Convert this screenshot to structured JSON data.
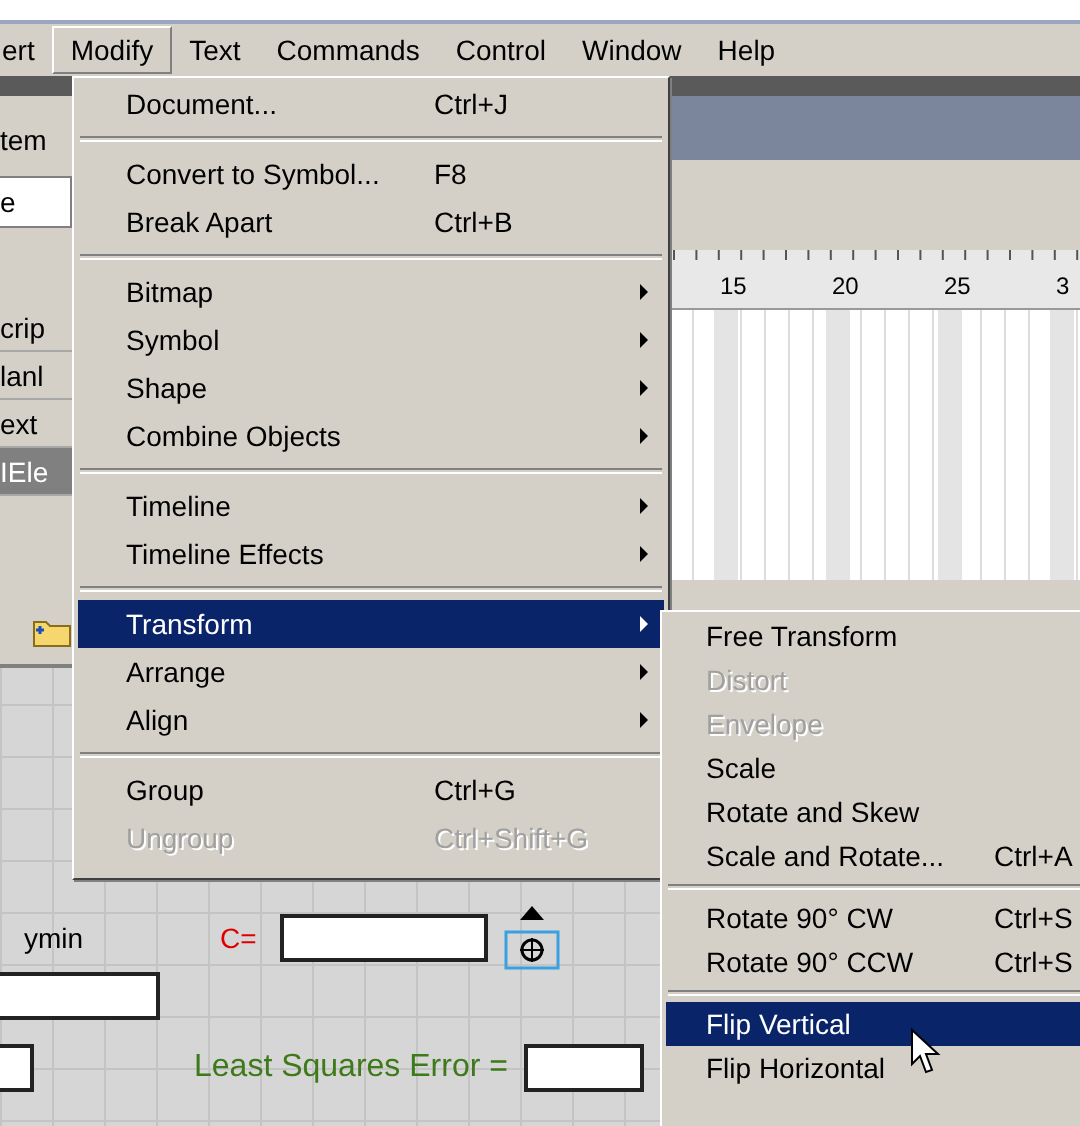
{
  "menu_bar": [
    {
      "label": "ert",
      "selected": false
    },
    {
      "label": "Modify",
      "selected": true
    },
    {
      "label": "Text",
      "selected": false
    },
    {
      "label": "Commands",
      "selected": false
    },
    {
      "label": "Control",
      "selected": false
    },
    {
      "label": "Window",
      "selected": false
    },
    {
      "label": "Help",
      "selected": false
    }
  ],
  "left_panel": {
    "header": "tem",
    "field": "e",
    "rows": [
      {
        "label": "crip",
        "selected": false
      },
      {
        "label": "lanl",
        "selected": false
      },
      {
        "label": "ext",
        "selected": false
      },
      {
        "label": "IEle",
        "selected": true
      }
    ]
  },
  "timeline": {
    "ruler": [
      "15",
      "20",
      "25",
      "3"
    ]
  },
  "stage": {
    "ymin_label": "ymin",
    "c_label": "C=",
    "error_label": "Least Squares Error ="
  },
  "modify_menu": [
    {
      "kind": "item",
      "label": "Document...",
      "shortcut": "Ctrl+J",
      "submenu": false,
      "selected": false,
      "disabled": false
    },
    {
      "kind": "separator"
    },
    {
      "kind": "item",
      "label": "Convert to Symbol...",
      "shortcut": "F8",
      "submenu": false,
      "selected": false,
      "disabled": false
    },
    {
      "kind": "item",
      "label": "Break Apart",
      "shortcut": "Ctrl+B",
      "submenu": false,
      "selected": false,
      "disabled": false
    },
    {
      "kind": "separator"
    },
    {
      "kind": "item",
      "label": "Bitmap",
      "submenu": true,
      "selected": false,
      "disabled": false
    },
    {
      "kind": "item",
      "label": "Symbol",
      "submenu": true,
      "selected": false,
      "disabled": false
    },
    {
      "kind": "item",
      "label": "Shape",
      "submenu": true,
      "selected": false,
      "disabled": false
    },
    {
      "kind": "item",
      "label": "Combine Objects",
      "submenu": true,
      "selected": false,
      "disabled": false
    },
    {
      "kind": "separator"
    },
    {
      "kind": "item",
      "label": "Timeline",
      "submenu": true,
      "selected": false,
      "disabled": false
    },
    {
      "kind": "item",
      "label": "Timeline Effects",
      "submenu": true,
      "selected": false,
      "disabled": false
    },
    {
      "kind": "separator"
    },
    {
      "kind": "item",
      "label": "Transform",
      "submenu": true,
      "selected": true,
      "disabled": false
    },
    {
      "kind": "item",
      "label": "Arrange",
      "submenu": true,
      "selected": false,
      "disabled": false
    },
    {
      "kind": "item",
      "label": "Align",
      "submenu": true,
      "selected": false,
      "disabled": false
    },
    {
      "kind": "separator"
    },
    {
      "kind": "item",
      "label": "Group",
      "shortcut": "Ctrl+G",
      "submenu": false,
      "selected": false,
      "disabled": false
    },
    {
      "kind": "item",
      "label": "Ungroup",
      "shortcut": "Ctrl+Shift+G",
      "submenu": false,
      "selected": false,
      "disabled": true
    }
  ],
  "transform_menu": [
    {
      "kind": "item",
      "label": "Free Transform",
      "selected": false,
      "disabled": false
    },
    {
      "kind": "item",
      "label": "Distort",
      "selected": false,
      "disabled": true
    },
    {
      "kind": "item",
      "label": "Envelope",
      "selected": false,
      "disabled": true
    },
    {
      "kind": "item",
      "label": "Scale",
      "selected": false,
      "disabled": false
    },
    {
      "kind": "item",
      "label": "Rotate and Skew",
      "selected": false,
      "disabled": false
    },
    {
      "kind": "item",
      "label": "Scale and Rotate...",
      "shortcut": "Ctrl+A",
      "selected": false,
      "disabled": false
    },
    {
      "kind": "separator"
    },
    {
      "kind": "item",
      "label": "Rotate 90° CW",
      "shortcut": "Ctrl+S",
      "selected": false,
      "disabled": false
    },
    {
      "kind": "item",
      "label": "Rotate 90° CCW",
      "shortcut": "Ctrl+S",
      "selected": false,
      "disabled": false
    },
    {
      "kind": "separator"
    },
    {
      "kind": "item",
      "label": "Flip Vertical",
      "selected": true,
      "disabled": false
    },
    {
      "kind": "item",
      "label": "Flip Horizontal",
      "selected": false,
      "disabled": false
    }
  ]
}
